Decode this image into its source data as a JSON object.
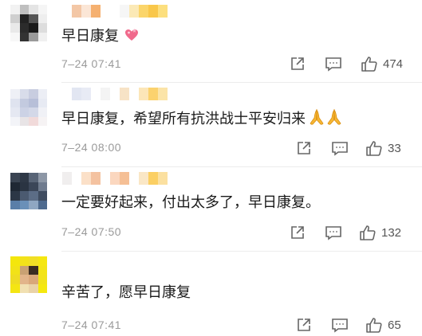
{
  "colors": {
    "text": "#1a1a1a",
    "meta": "#9a9a9a",
    "icon": "#666666"
  },
  "icons": {
    "share": "share-icon",
    "comment": "comment-icon",
    "like": "thumbs-up-icon",
    "heart": "heart-emoji-icon",
    "pray": "folded-hands-emoji-icon"
  },
  "comments": [
    {
      "text": "早日康复",
      "time": "7–24 07:41",
      "likes": "474"
    },
    {
      "text": "早日康复，希望所有抗洪战士平安归来",
      "time": "7–24 08:00",
      "likes": "33"
    },
    {
      "text": "一定要好起来，付出太多了，早日康复。",
      "time": "7–24 07:50",
      "likes": "132"
    },
    {
      "text": "辛苦了，愿早日康复",
      "time": "7–24 07:41",
      "likes": "65"
    }
  ]
}
